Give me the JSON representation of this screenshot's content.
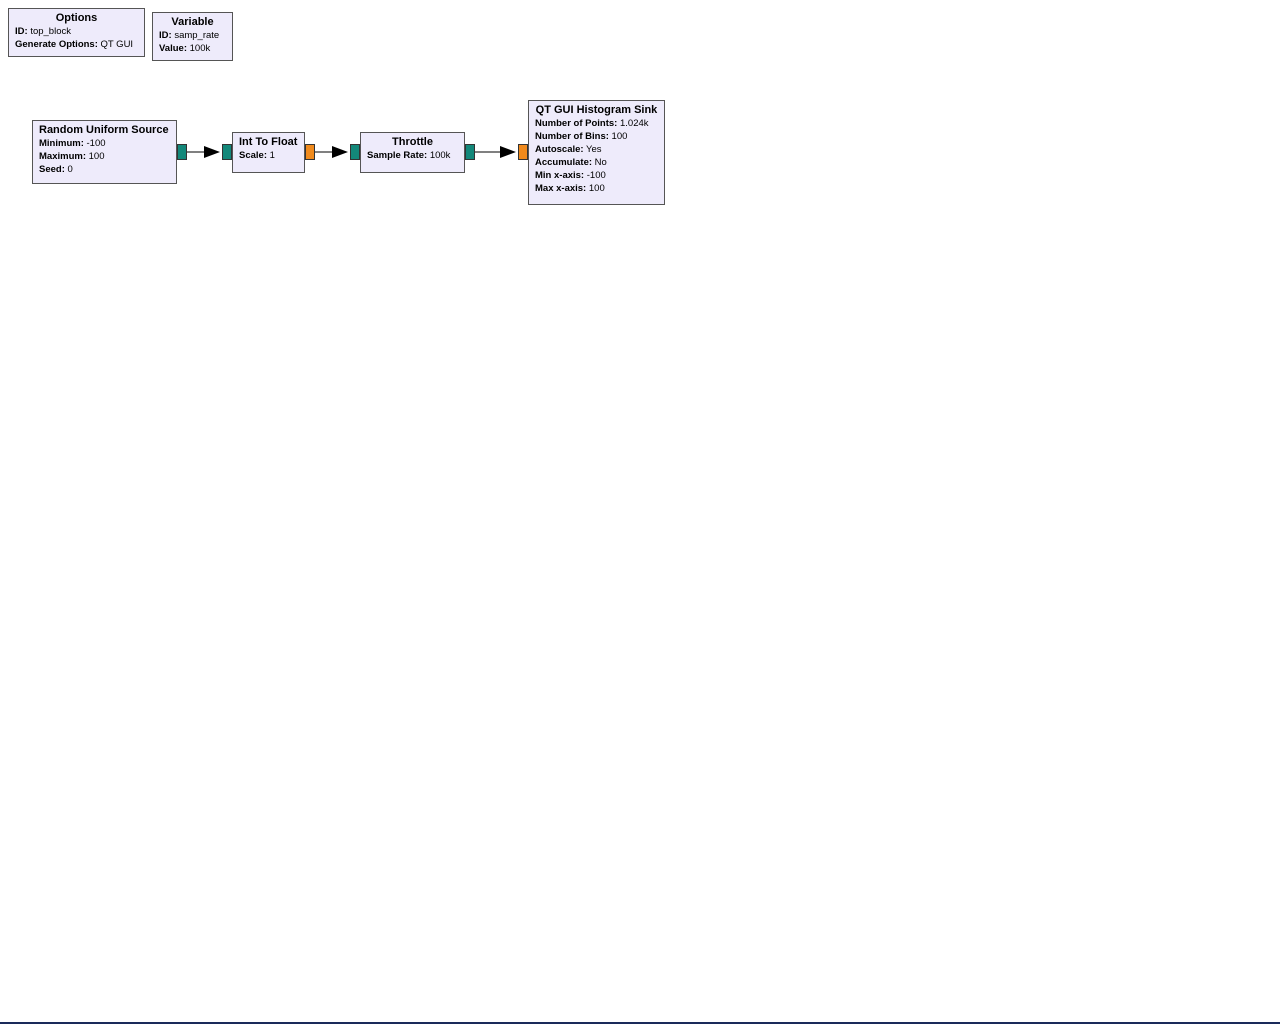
{
  "blocks": {
    "options": {
      "title": "Options",
      "params": [
        {
          "key": "ID:",
          "value": "top_block"
        },
        {
          "key": "Generate Options:",
          "value": "QT GUI"
        }
      ]
    },
    "variable": {
      "title": "Variable",
      "params": [
        {
          "key": "ID:",
          "value": "samp_rate"
        },
        {
          "key": "Value:",
          "value": "100k"
        }
      ]
    },
    "random_source": {
      "title": "Random Uniform Source",
      "params": [
        {
          "key": "Minimum:",
          "value": "-100"
        },
        {
          "key": "Maximum:",
          "value": "100"
        },
        {
          "key": "Seed:",
          "value": "0"
        }
      ]
    },
    "int_to_float": {
      "title": "Int To Float",
      "params": [
        {
          "key": "Scale:",
          "value": "1"
        }
      ]
    },
    "throttle": {
      "title": "Throttle",
      "params": [
        {
          "key": "Sample Rate:",
          "value": "100k"
        }
      ]
    },
    "histogram_sink": {
      "title": "QT GUI Histogram Sink",
      "params": [
        {
          "key": "Number of Points:",
          "value": "1.024k"
        },
        {
          "key": "Number of Bins:",
          "value": "100"
        },
        {
          "key": "Autoscale:",
          "value": "Yes"
        },
        {
          "key": "Accumulate:",
          "value": "No"
        },
        {
          "key": "Min x-axis:",
          "value": "-100"
        },
        {
          "key": "Max x-axis:",
          "value": "100"
        }
      ]
    }
  },
  "colors": {
    "block_fill": "#eeebfb",
    "int_port": "#13887a",
    "float_port": "#f08a1c",
    "wire": "#000000"
  }
}
